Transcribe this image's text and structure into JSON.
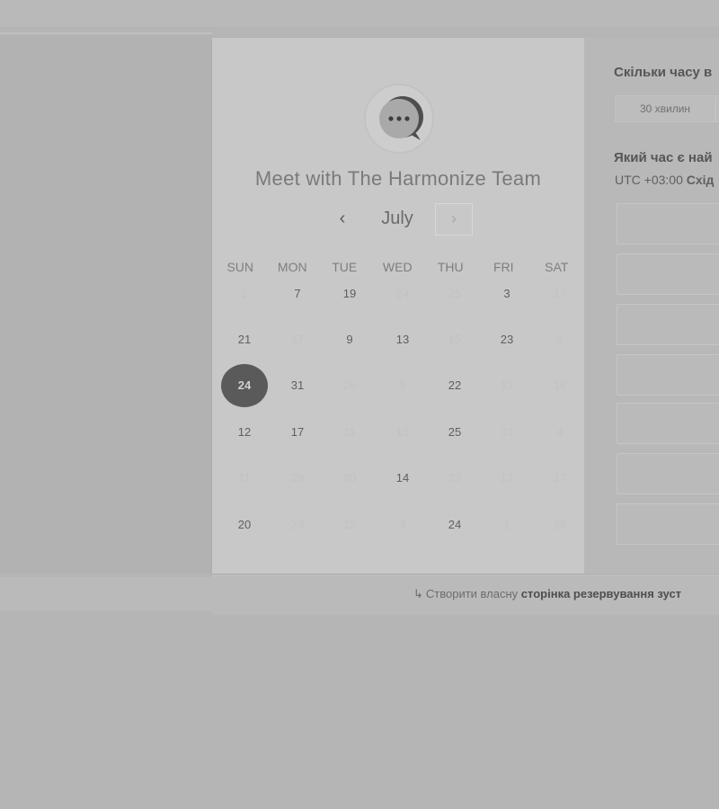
{
  "card": {
    "title": "Meet with The Harmonize Team",
    "month": "July",
    "prev_icon": "‹",
    "next_icon": "›",
    "weekdays": [
      "SUN",
      "MON",
      "TUE",
      "WED",
      "THU",
      "FRI",
      "SAT"
    ],
    "calendar_rows": [
      [
        {
          "t": "1",
          "a": false
        },
        {
          "t": "7",
          "a": true
        },
        {
          "t": "19",
          "a": true
        },
        {
          "t": "24",
          "a": false
        },
        {
          "t": "25",
          "a": false
        },
        {
          "t": "3",
          "a": true
        },
        {
          "t": "17",
          "a": false
        }
      ],
      [
        {
          "t": "21",
          "a": true
        },
        {
          "t": "17",
          "a": false
        },
        {
          "t": "9",
          "a": true
        },
        {
          "t": "13",
          "a": true
        },
        {
          "t": "15",
          "a": false
        },
        {
          "t": "23",
          "a": true
        },
        {
          "t": "5",
          "a": false
        }
      ],
      [
        {
          "t": "24",
          "a": true,
          "selected": true
        },
        {
          "t": "31",
          "a": true
        },
        {
          "t": "26",
          "a": false
        },
        {
          "t": "9",
          "a": false
        },
        {
          "t": "22",
          "a": true
        },
        {
          "t": "13",
          "a": false
        },
        {
          "t": "16",
          "a": false
        }
      ],
      [
        {
          "t": "12",
          "a": true
        },
        {
          "t": "17",
          "a": true
        },
        {
          "t": "11",
          "a": false
        },
        {
          "t": "15",
          "a": false
        },
        {
          "t": "25",
          "a": true
        },
        {
          "t": "31",
          "a": false
        },
        {
          "t": "4",
          "a": false
        }
      ],
      [
        {
          "t": "11",
          "a": false
        },
        {
          "t": "29",
          "a": false
        },
        {
          "t": "20",
          "a": false
        },
        {
          "t": "14",
          "a": true
        },
        {
          "t": "20",
          "a": false
        },
        {
          "t": "12",
          "a": false
        },
        {
          "t": "17",
          "a": false
        }
      ],
      [
        {
          "t": "20",
          "a": true
        },
        {
          "t": "23",
          "a": false
        },
        {
          "t": "12",
          "a": false
        },
        {
          "t": "4",
          "a": false
        },
        {
          "t": "24",
          "a": true
        },
        {
          "t": "1",
          "a": false
        },
        {
          "t": "25",
          "a": false
        }
      ]
    ]
  },
  "right": {
    "duration_question": "Скільки часу в",
    "duration_option": "30 хвилин",
    "time_question": "Який час є най",
    "timezone_offset": "UTC +03:00",
    "timezone_name": "Схід"
  },
  "footer": {
    "icon": "↳",
    "link_text": "Створити власну",
    "link_strong": "сторінка резервування зуст"
  },
  "colors": {
    "selected_day": "#5a5a5a",
    "card_bg": "#c8c8c8",
    "page_bg": "#b5b5b5"
  }
}
